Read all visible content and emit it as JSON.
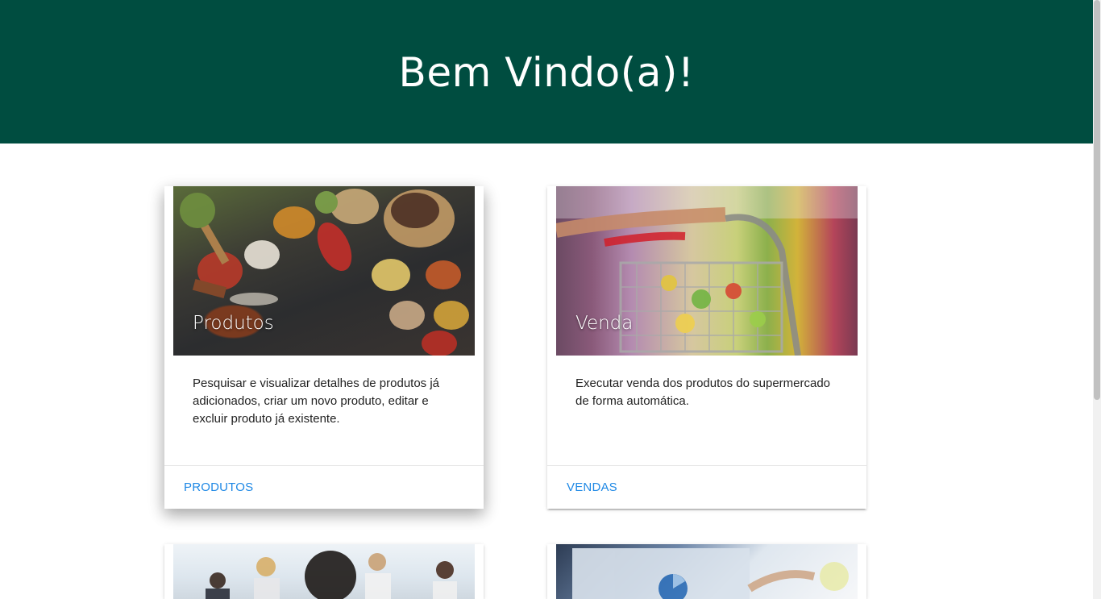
{
  "header": {
    "title": "Bem Vindo(a)!"
  },
  "cards": [
    {
      "title": "Produtos",
      "image": "spices-photo",
      "description": "Pesquisar e visualizar detalhes de produtos já adicionados, criar um novo produto, editar e excluir produto já existente.",
      "action": "PRODUTOS"
    },
    {
      "title": "Venda",
      "image": "shopping-cart-photo",
      "description": "Executar venda dos produtos do supermercado de forma automática.",
      "action": "VENDAS"
    },
    {
      "title": "",
      "image": "team-photo"
    },
    {
      "title": "",
      "image": "laptop-chart-photo"
    }
  ],
  "colors": {
    "header_bg": "#004d40",
    "link": "#1e88e5"
  }
}
